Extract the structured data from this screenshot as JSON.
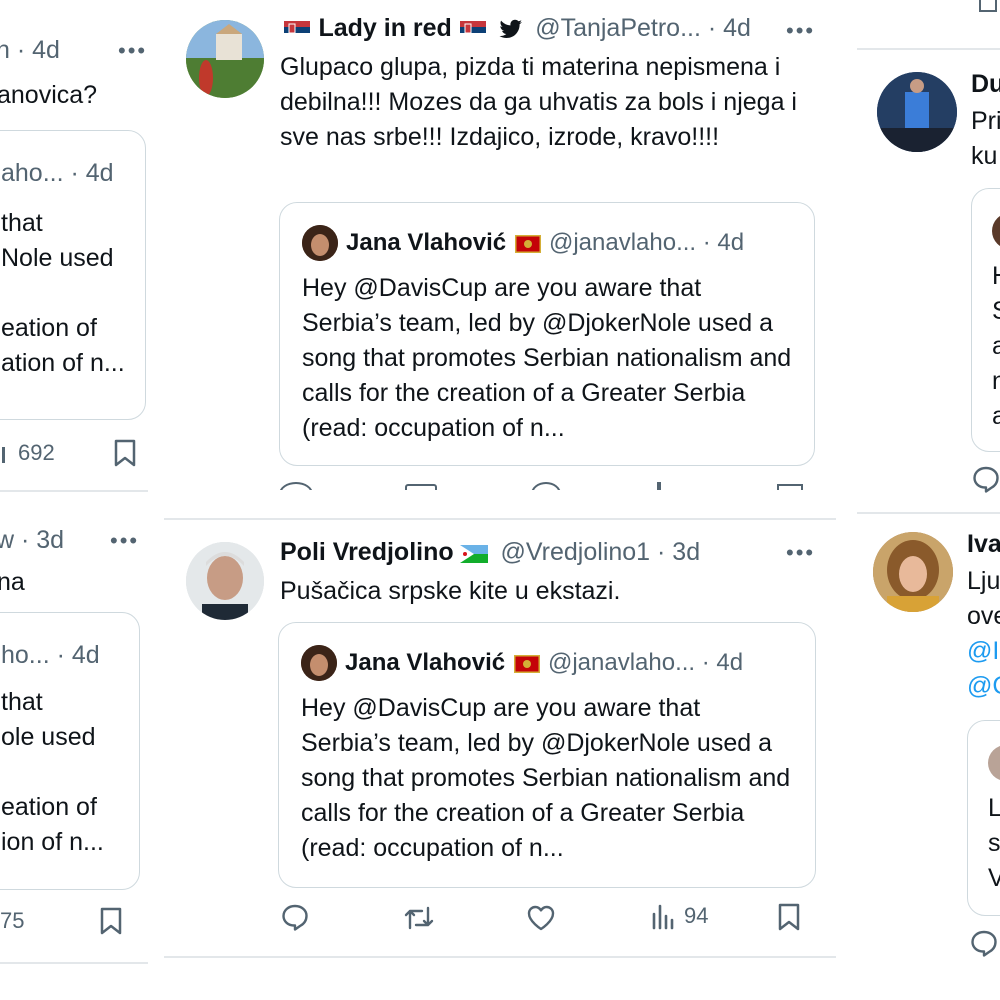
{
  "left": {
    "t1_meta": "n · 4d",
    "t1_body": "anovica?",
    "t1_q_meta": "aho... · 4d",
    "t1_q_lines": [
      "that",
      "Nole used",
      "",
      "eation of",
      "ation of n..."
    ],
    "t1_views": "692",
    "t2_meta": "w · 3d",
    "t2_body": "na",
    "t2_q_meta": "ho... · 4d",
    "t2_q_lines": [
      "that",
      "ole used",
      "",
      "eation of",
      "ion of n..."
    ],
    "t2_views": "75"
  },
  "center": {
    "t1": {
      "name": "Lady in red",
      "handle": "@TanjaPetro... · 4d",
      "body": "Glupaco glupa, pizda ti materina nepismena i debilna!!! Mozes da ga uhvatis za bols i njega i sve nas srbe!!! Izdajico, izrode, kravo!!!!"
    },
    "t2": {
      "name": "Poli Vredjolino",
      "handle": "@Vredjolino1 · 3d",
      "body": "Pušačica srpske kite u ekstazi.",
      "views": "94"
    },
    "quote": {
      "name": "Jana Vlahović",
      "handle": "@janavlaho... · 4d",
      "body": "Hey @DavisCup are you aware that Serbia’s team, led by @DjokerNole used a song that promotes Serbian nationalism and calls for the creation of a Greater Serbia (read: occupation of n..."
    }
  },
  "right": {
    "t1_name": "Du",
    "t1_lines": [
      "Pri",
      "ku"
    ],
    "t1_q_lines": [
      "H",
      "S",
      "a",
      "n",
      "a"
    ],
    "t2_name": "Iva",
    "t2_lines": [
      "Lju",
      "ove"
    ],
    "t2_links": [
      "@I",
      "@C"
    ],
    "t2_q_lines": [
      "L",
      "s",
      "V"
    ]
  },
  "colors": {
    "accent": "#1d9bf0",
    "secondary_text": "#536471",
    "border": "#cfd9de"
  },
  "icons": [
    "more-icon",
    "reply-icon",
    "retweet-icon",
    "like-icon",
    "views-icon",
    "bookmark-icon",
    "twitter-bird-icon",
    "serbia-flag-icon",
    "montenegro-flag-icon",
    "djibouti-flag-icon"
  ]
}
